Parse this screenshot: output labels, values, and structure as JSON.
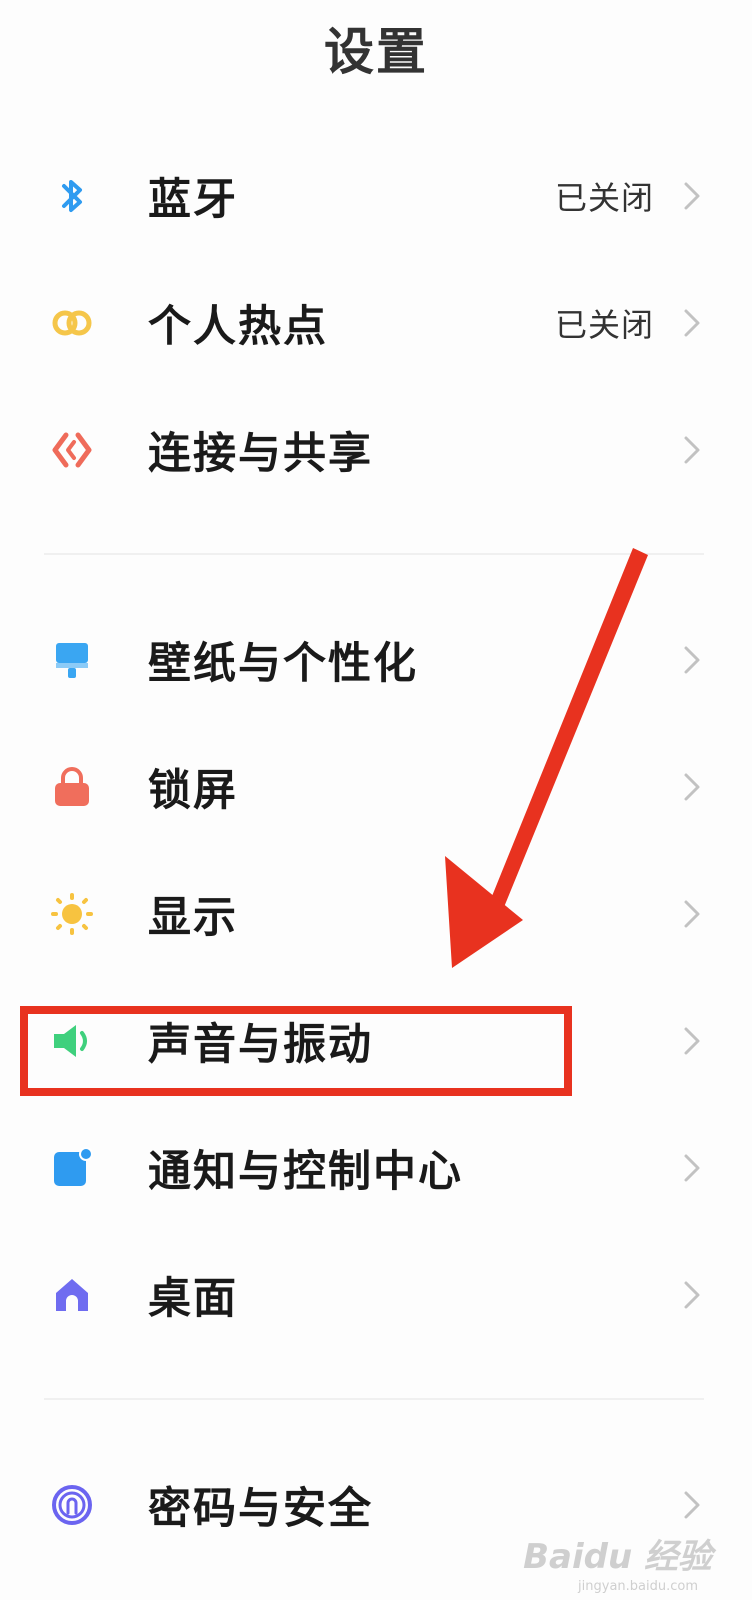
{
  "header": {
    "title": "设置"
  },
  "groups": [
    {
      "items": [
        {
          "label": "蓝牙",
          "status": "已关闭",
          "icon": "bluetooth-icon",
          "color": "#2f9bf0"
        },
        {
          "label": "个人热点",
          "status": "已关闭",
          "icon": "hotspot-icon",
          "color": "#f5c64a"
        },
        {
          "label": "连接与共享",
          "status": "",
          "icon": "connection-share-icon",
          "color": "#ef6b5a"
        }
      ]
    },
    {
      "items": [
        {
          "label": "壁纸与个性化",
          "status": "",
          "icon": "wallpaper-icon",
          "color": "#3aa6f2"
        },
        {
          "label": "锁屏",
          "status": "",
          "icon": "lock-icon",
          "color": "#f06e5c"
        },
        {
          "label": "显示",
          "status": "",
          "icon": "sun-icon",
          "color": "#f7c340"
        },
        {
          "label": "声音与振动",
          "status": "",
          "icon": "speaker-icon",
          "color": "#3fd07d"
        },
        {
          "label": "通知与控制中心",
          "status": "",
          "icon": "notification-icon",
          "color": "#2f9bf0"
        },
        {
          "label": "桌面",
          "status": "",
          "icon": "home-icon",
          "color": "#6f6cf0"
        }
      ]
    },
    {
      "items": [
        {
          "label": "密码与安全",
          "status": "",
          "icon": "fingerprint-icon",
          "color": "#6b64f0"
        }
      ]
    }
  ],
  "annotation": {
    "highlight_color": "#e8321f"
  },
  "watermark": {
    "text": "Baidu 经验",
    "sub": "jingyan.baidu.com"
  }
}
